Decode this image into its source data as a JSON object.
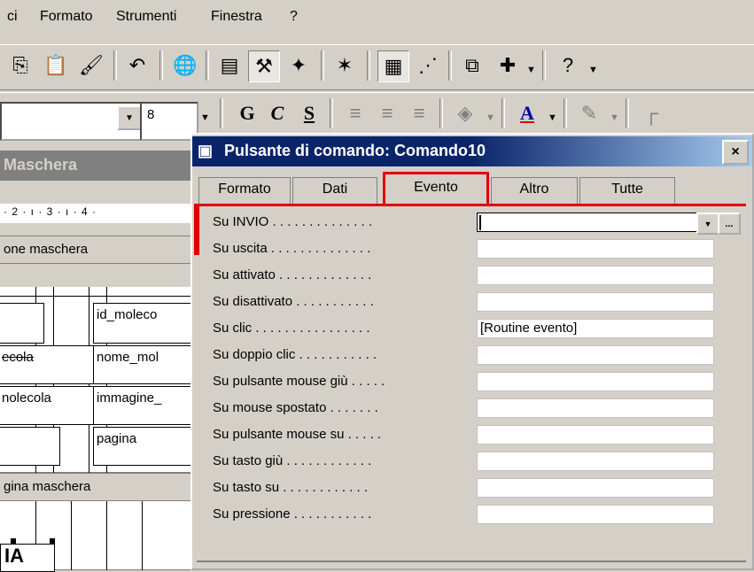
{
  "menu": [
    "ci",
    "Formato",
    "Strumenti",
    "Finestra",
    "?"
  ],
  "toolbar": {
    "font_combo_value": "",
    "size_combo_value": "8",
    "bold": "G",
    "italic": "C",
    "underline": "S",
    "font_color_letter": "A"
  },
  "form_window": {
    "caption": "Maschera",
    "ruler": "· 2 · ı · 3 · ı · 4 ·",
    "header_section": "one maschera",
    "labels": [
      "",
      "ecola",
      "nolecola",
      ""
    ],
    "fields": [
      "id_moleco",
      "nome_mol",
      "immagine_",
      "pagina"
    ],
    "footer_section": "gina maschera"
  },
  "dialog": {
    "title": "Pulsante di comando: Comando10",
    "close": "×",
    "tabs": [
      "Formato",
      "Dati",
      "Evento",
      "Altro",
      "Tutte"
    ],
    "active_tab": "Evento",
    "properties": [
      {
        "label": "Su INVIO . . . . . . . . . . . . . .",
        "value": ""
      },
      {
        "label": "Su uscita . . . . . . . . . . . . . .",
        "value": ""
      },
      {
        "label": "Su attivato . . . . . . . . . . . . .",
        "value": ""
      },
      {
        "label": "Su disattivato . . . . . . . . . . .",
        "value": ""
      },
      {
        "label": "Su clic . . . . . . . . . . . . . . . .",
        "value": "[Routine evento]"
      },
      {
        "label": "Su doppio clic . . . . . . . . . . .",
        "value": ""
      },
      {
        "label": "Su pulsante mouse giù . . . . .",
        "value": ""
      },
      {
        "label": "Su mouse spostato . . . . . . .",
        "value": ""
      },
      {
        "label": "Su pulsante mouse su . . . . .",
        "value": ""
      },
      {
        "label": "Su tasto giù . . . . . . . . . . . .",
        "value": ""
      },
      {
        "label": "Su tasto su . . . . . . . . . . . .",
        "value": ""
      },
      {
        "label": "Su pressione . . . . . . . . . . .",
        "value": ""
      }
    ],
    "dropdown_btn": "▼",
    "builder_btn": "..."
  },
  "colors": {
    "highlight": "#e00000",
    "titlebar": "#0a246a",
    "face": "#d4d0c8"
  }
}
